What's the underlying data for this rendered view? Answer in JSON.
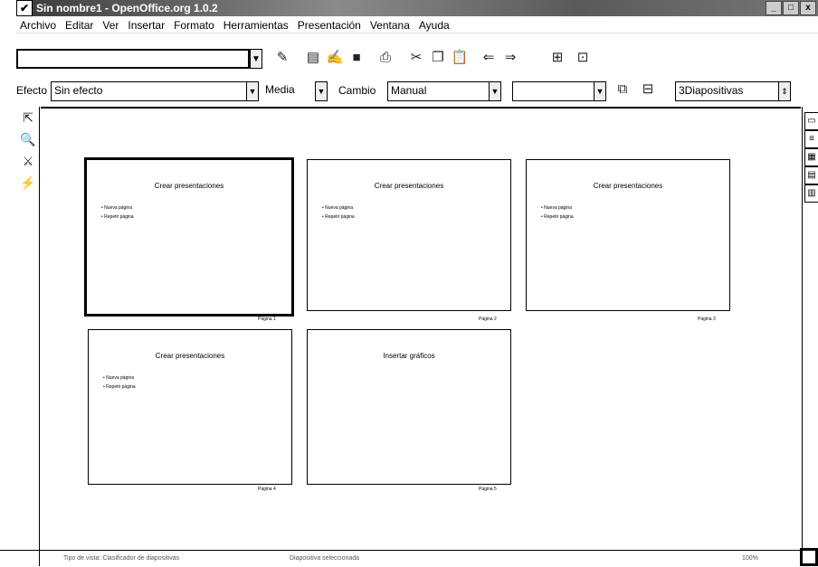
{
  "window": {
    "title": "Sin nombre1 - OpenOffice.org 1.0.2",
    "controls": [
      "_",
      "□",
      "x"
    ]
  },
  "menu": [
    "Archivo",
    "Editar",
    "Ver",
    "Insertar",
    "Formato",
    "Herramientas",
    "Presentación",
    "Ventana",
    "Ayuda"
  ],
  "toolbar1": {
    "url_value": "",
    "icons": [
      "new-icon",
      "open-icon",
      "save-icon",
      "print-icon",
      "cut-icon",
      "copy-icon",
      "paste-icon",
      "undo-icon",
      "navigator-icon"
    ]
  },
  "toolbar2": {
    "effect_label": "Efecto",
    "effect_value": "Sin efecto",
    "speed_value": "Media",
    "change_label": "Cambio",
    "change_value": "Manual",
    "timing_value": "",
    "slides_value": "3Diapositivas"
  },
  "slides": [
    {
      "title": "Crear presentaciones",
      "bullets": [
        "Nueva página",
        "Repetir página"
      ],
      "label": "Página 1"
    },
    {
      "title": "Crear presentaciones",
      "bullets": [
        "Nueva página",
        "Repetir página"
      ],
      "label": "Página 2"
    },
    {
      "title": "Crear presentaciones",
      "bullets": [
        "Nueva página",
        "Repetir página"
      ],
      "label": "Página 3"
    },
    {
      "title": "Crear presentaciones",
      "bullets": [
        "Nueva página",
        "Repetir página"
      ],
      "label": "Página 4"
    },
    {
      "title": "Insertar gráficos",
      "bullets": [],
      "label": "Página 5"
    }
  ],
  "statusbar": {
    "left": "Tipo de vista: Clasificador de diapositivas",
    "middle": "Diapositiva seleccionada",
    "right": "100%"
  }
}
